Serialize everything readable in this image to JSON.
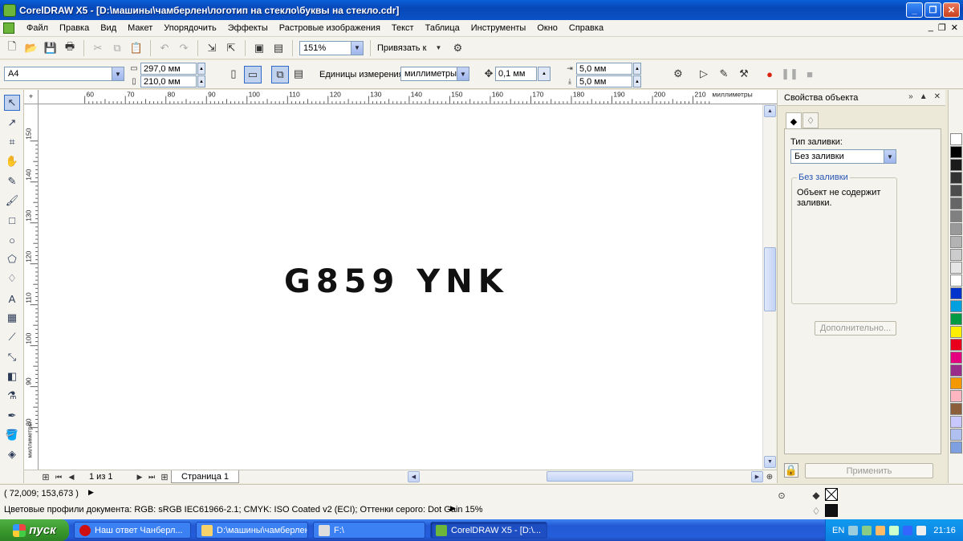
{
  "window": {
    "title": "CorelDRAW X5 - [D:\\машины\\чамберлен\\логотип на стекло\\буквы на стекло.cdr]"
  },
  "menu": [
    "Файл",
    "Правка",
    "Вид",
    "Макет",
    "Упорядочить",
    "Эффекты",
    "Растровые изображения",
    "Текст",
    "Таблица",
    "Инструменты",
    "Окно",
    "Справка"
  ],
  "toolbar": {
    "zoom": "151%",
    "snap_label": "Привязать к"
  },
  "propbar": {
    "page_size": "A4",
    "width": "297,0 мм",
    "height": "210,0 мм",
    "units_label": "Единицы измерения:",
    "units_value": "миллиметры",
    "nudge": "0,1 мм",
    "dup_x": "5,0 мм",
    "dup_y": "5,0 мм"
  },
  "ruler": {
    "units_label": "миллиметры",
    "top_ticks": [
      "60",
      "70",
      "80",
      "90",
      "100",
      "110",
      "120",
      "130",
      "140",
      "150",
      "160",
      "170",
      "180",
      "190",
      "200",
      "210"
    ],
    "left_ticks": [
      "150",
      "140",
      "130",
      "120",
      "110",
      "100",
      "90",
      "80"
    ]
  },
  "canvas": {
    "text": "G859 YNK"
  },
  "page_nav": {
    "counter": "1 из 1",
    "tab": "Страница 1"
  },
  "docker": {
    "title": "Свойства объекта",
    "fill_type_label": "Тип заливки:",
    "fill_type_value": "Без заливки",
    "group_title": "Без заливки",
    "group_desc": "Объект не содержит заливки.",
    "more_button": "Дополнительно...",
    "apply_button": "Применить"
  },
  "palette_colors": [
    "#ffffff",
    "#000000",
    "#1a1a1a",
    "#333333",
    "#4d4d4d",
    "#666666",
    "#808080",
    "#999999",
    "#b3b3b3",
    "#cccccc",
    "#e6e6e6",
    "#ffffff",
    "#0033cc",
    "#00a0e0",
    "#009944",
    "#ffee00",
    "#e8001c",
    "#e4007f",
    "#9b2d8a",
    "#f39800",
    "#ffb6c1",
    "#8b5e3c",
    "#c8c8ff",
    "#b0c0f0",
    "#7fa0e0"
  ],
  "status": {
    "coords": "( 72,009; 153,673 )",
    "profiles": "Цветовые профили документа: RGB: sRGB IEC61966-2.1; CMYK: ISO Coated v2 (ECI); Оттенки серого: Dot Gain 15%"
  },
  "taskbar": {
    "start": "пуск",
    "tasks": [
      "Наш ответ Чанберл...",
      "D:\\машины\\чамберлен...",
      "F:\\",
      "CorelDRAW X5 - [D:\\..."
    ],
    "lang": "EN",
    "clock": "21:16"
  }
}
